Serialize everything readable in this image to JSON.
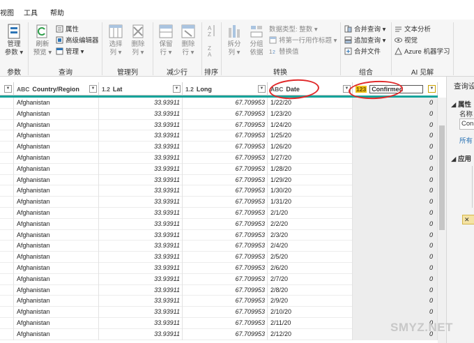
{
  "menu": {
    "items": [
      "视图",
      "工具",
      "帮助"
    ]
  },
  "ribbon": {
    "groups": {
      "params": "参数",
      "query": "查询",
      "manage_cols": "管理列",
      "reduce_rows": "减少行",
      "sort": "排序",
      "transform": "转换",
      "combine": "组合",
      "ai": "AI 见解"
    },
    "manage_params": [
      "管理",
      "参数 ▾"
    ],
    "refresh_preview": [
      "刷新",
      "预览 ▾"
    ],
    "properties": "属性",
    "advanced_editor": "高级编辑器",
    "manage": "管理 ▾",
    "choose_cols": [
      "选择",
      "列 ▾"
    ],
    "remove_cols": [
      "删除",
      "列 ▾"
    ],
    "keep_rows": [
      "保留",
      "行 ▾"
    ],
    "remove_rows": [
      "删除",
      "行 ▾"
    ],
    "split_col": [
      "拆分",
      "列 ▾"
    ],
    "group_by": [
      "分组",
      "依据"
    ],
    "data_type": "数据类型: 整数 ▾",
    "first_row_header": "将第一行用作标题 ▾",
    "replace_values": "替换值",
    "merge_queries": "合并查询 ▾",
    "append_queries": "追加查询 ▾",
    "combine_files": "合并文件",
    "text_analytics": "文本分析",
    "vision": "视觉",
    "azure_ml": "Azure 机器学习"
  },
  "grid": {
    "columns": [
      {
        "type": "ABC",
        "name": "Country/Region"
      },
      {
        "type": "1.2",
        "name": "Lat"
      },
      {
        "type": "1.2",
        "name": "Long"
      },
      {
        "type": "ABC",
        "name": "Date"
      },
      {
        "type": "123",
        "name": "Confirmed"
      }
    ],
    "rows": [
      [
        "Afghanistan",
        "33.93911",
        "67.709953",
        "1/22/20",
        "0"
      ],
      [
        "Afghanistan",
        "33.93911",
        "67.709953",
        "1/23/20",
        "0"
      ],
      [
        "Afghanistan",
        "33.93911",
        "67.709953",
        "1/24/20",
        "0"
      ],
      [
        "Afghanistan",
        "33.93911",
        "67.709953",
        "1/25/20",
        "0"
      ],
      [
        "Afghanistan",
        "33.93911",
        "67.709953",
        "1/26/20",
        "0"
      ],
      [
        "Afghanistan",
        "33.93911",
        "67.709953",
        "1/27/20",
        "0"
      ],
      [
        "Afghanistan",
        "33.93911",
        "67.709953",
        "1/28/20",
        "0"
      ],
      [
        "Afghanistan",
        "33.93911",
        "67.709953",
        "1/29/20",
        "0"
      ],
      [
        "Afghanistan",
        "33.93911",
        "67.709953",
        "1/30/20",
        "0"
      ],
      [
        "Afghanistan",
        "33.93911",
        "67.709953",
        "1/31/20",
        "0"
      ],
      [
        "Afghanistan",
        "33.93911",
        "67.709953",
        "2/1/20",
        "0"
      ],
      [
        "Afghanistan",
        "33.93911",
        "67.709953",
        "2/2/20",
        "0"
      ],
      [
        "Afghanistan",
        "33.93911",
        "67.709953",
        "2/3/20",
        "0"
      ],
      [
        "Afghanistan",
        "33.93911",
        "67.709953",
        "2/4/20",
        "0"
      ],
      [
        "Afghanistan",
        "33.93911",
        "67.709953",
        "2/5/20",
        "0"
      ],
      [
        "Afghanistan",
        "33.93911",
        "67.709953",
        "2/6/20",
        "0"
      ],
      [
        "Afghanistan",
        "33.93911",
        "67.709953",
        "2/7/20",
        "0"
      ],
      [
        "Afghanistan",
        "33.93911",
        "67.709953",
        "2/8/20",
        "0"
      ],
      [
        "Afghanistan",
        "33.93911",
        "67.709953",
        "2/9/20",
        "0"
      ],
      [
        "Afghanistan",
        "33.93911",
        "67.709953",
        "2/10/20",
        "0"
      ],
      [
        "Afghanistan",
        "33.93911",
        "67.709953",
        "2/11/20",
        "0"
      ],
      [
        "Afghanistan",
        "33.93911",
        "67.709953",
        "2/12/20",
        "0"
      ]
    ]
  },
  "right_panel": {
    "title": "查询设",
    "properties": "属性",
    "name_label": "名称",
    "name_value": "Con",
    "all_props": "所有",
    "applied_steps": "应用"
  },
  "watermark": "SMYZ.NET",
  "colors": {
    "accent_teal": "#16a39a",
    "annotation_red": "#e0292a",
    "confirmed_icon": "#f0c419"
  }
}
